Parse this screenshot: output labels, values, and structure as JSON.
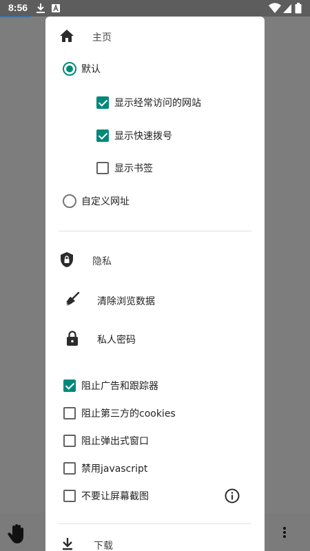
{
  "status_bar": {
    "time": "8:56",
    "icons": [
      "download-icon",
      "a-badge-icon",
      "wifi-icon",
      "signal-icon",
      "battery-icon"
    ]
  },
  "dialog": {
    "home_section": {
      "title": "主页",
      "icon": "home-icon",
      "radio_default": {
        "label": "默认",
        "selected": true
      },
      "default_options": [
        {
          "label": "显示经常访问的网站",
          "checked": true
        },
        {
          "label": "显示快速拨号",
          "checked": true
        },
        {
          "label": "显示书签",
          "checked": false
        }
      ],
      "radio_custom": {
        "label": "自定义网址",
        "selected": false
      }
    },
    "privacy_section": {
      "title": "隐私",
      "icon": "shield-icon",
      "actions": [
        {
          "label": "清除浏览数据",
          "icon": "broom-icon"
        },
        {
          "label": "私人密码",
          "icon": "lock-icon"
        }
      ],
      "options": [
        {
          "label": "阻止广告和跟踪器",
          "checked": true
        },
        {
          "label": "阻止第三方的cookies",
          "checked": false
        },
        {
          "label": "阻止弹出式窗口",
          "checked": false
        },
        {
          "label": "禁用javascript",
          "checked": false
        },
        {
          "label": "不要让屏幕截图",
          "checked": false,
          "info_icon": "info-icon"
        }
      ]
    },
    "download_section": {
      "title": "下载",
      "icon": "download-icon"
    }
  },
  "colors": {
    "accent": "#00897b",
    "scrim": "#7d7d7d",
    "status_bar": "#5d5d5d"
  }
}
